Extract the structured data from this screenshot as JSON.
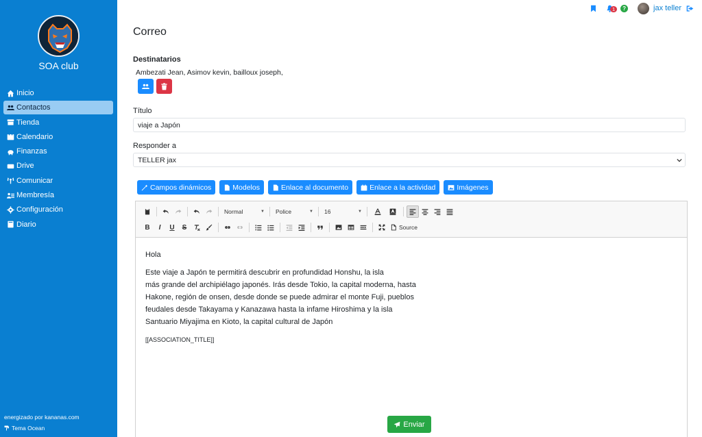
{
  "sidebar": {
    "club_name": "SOA club",
    "items": [
      {
        "label": "Inicio",
        "icon": "home-icon"
      },
      {
        "label": "Contactos",
        "icon": "users-icon",
        "active": true
      },
      {
        "label": "Tienda",
        "icon": "store-icon"
      },
      {
        "label": "Calendario",
        "icon": "calendar-icon"
      },
      {
        "label": "Finanzas",
        "icon": "piggy-bank-icon"
      },
      {
        "label": "Drive",
        "icon": "drive-icon"
      },
      {
        "label": "Comunicar",
        "icon": "broadcast-icon"
      },
      {
        "label": "Membresía",
        "icon": "membership-icon"
      },
      {
        "label": "Configuración",
        "icon": "gear-icon"
      },
      {
        "label": "Diario",
        "icon": "book-icon"
      }
    ],
    "powered_by": "energizado por kananas.com",
    "theme": "Tema Ocean"
  },
  "topbar": {
    "notification_count": "1",
    "help": "?",
    "user_name": "jax teller"
  },
  "page": {
    "title": "Correo"
  },
  "recipients": {
    "label": "Destinatarios",
    "names": "Ambezati Jean,  Asimov kevin,  bailloux joseph,"
  },
  "subject": {
    "label": "Título",
    "value": "viaje a Japón"
  },
  "reply_to": {
    "label": "Responder a",
    "value": "TELLER jax"
  },
  "tools": {
    "dynamic_fields": "Campos dinámicos",
    "templates": "Modelos",
    "doc_link": "Enlace al documento",
    "activity_link": "Enlace a la actividad",
    "images": "Imágenes"
  },
  "editor_toolbar": {
    "format": "Normal",
    "font": "Police",
    "size": "16",
    "bold": "B",
    "italic": "I",
    "underline": "U",
    "strike": "S",
    "source": "Source"
  },
  "body": {
    "greeting": "Hola",
    "lines": [
      "Este viaje a Japón te permitirá descubrir en profundidad Honshu, la isla",
      "más grande del archipiélago japonés. Irás desde Tokio, la capital moderna, hasta",
      "Hakone, región de onsen, desde donde se puede admirar el monte Fuji, pueblos",
      "feudales desde Takayama y Kanazawa hasta la infame Hiroshima y la isla",
      "Santuario Miyajima en Kioto, la capital cultural de Japón"
    ],
    "placeholder": "[[ASSOCIATION_TITLE]]"
  },
  "send_label": "Enviar",
  "colors": {
    "sidebar": "#0a7fd1",
    "primary": "#1a8cff",
    "danger": "#dc3545",
    "success": "#28a745"
  }
}
